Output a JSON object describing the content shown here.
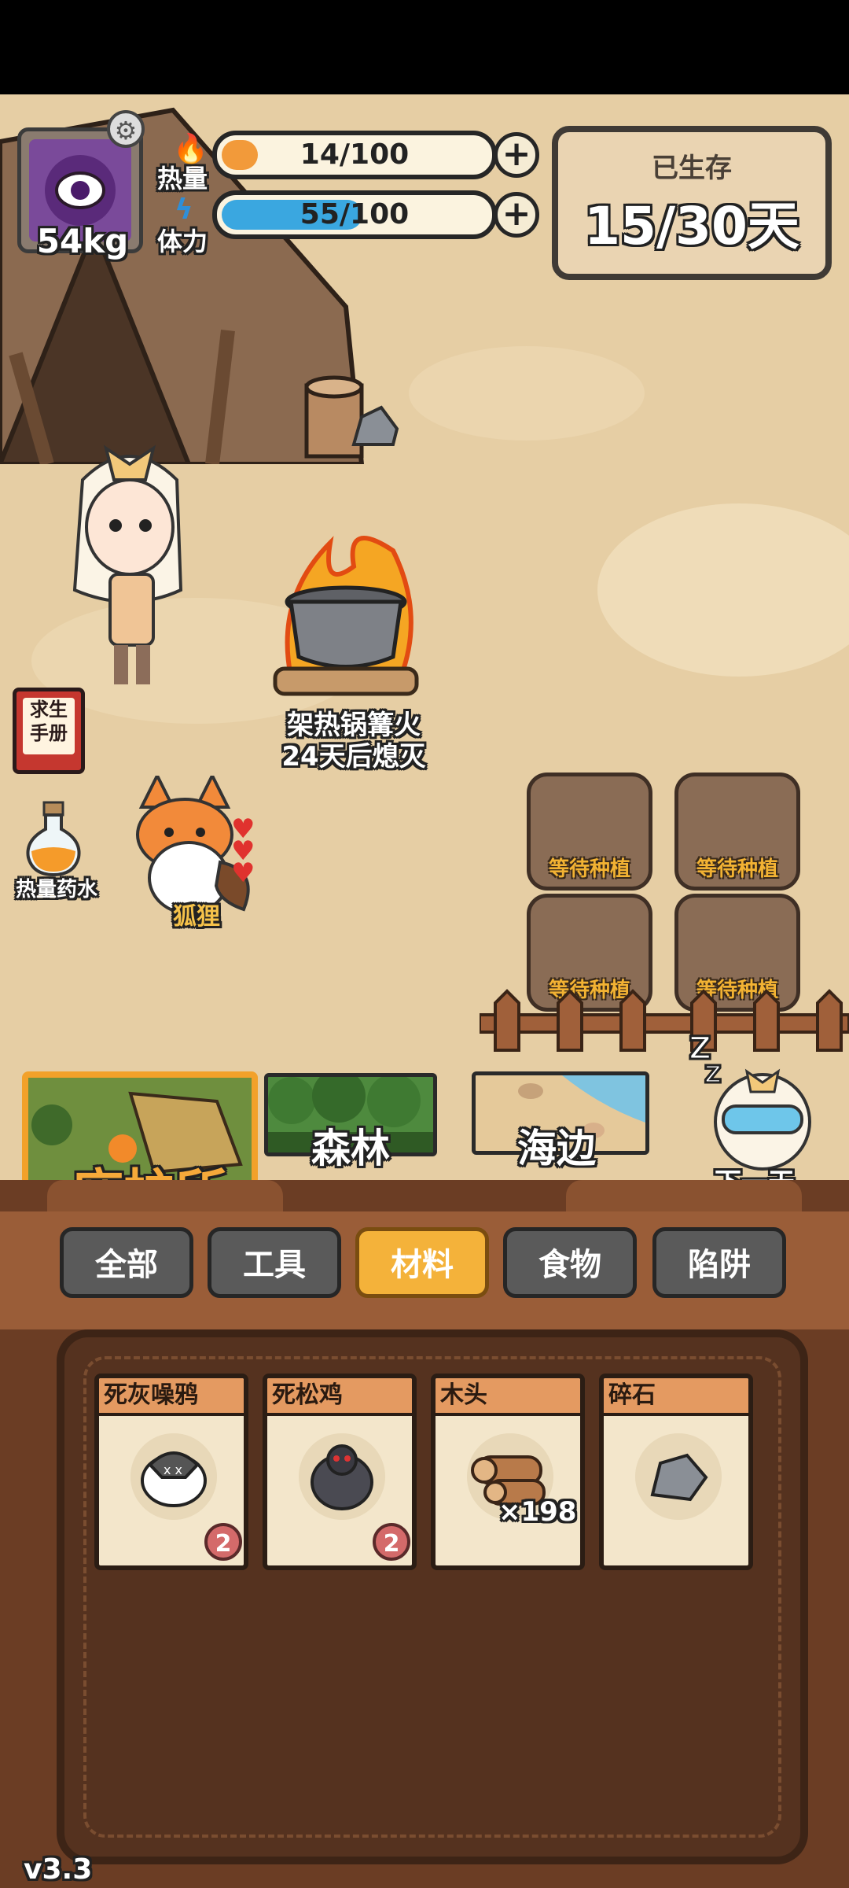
{
  "hud": {
    "avatar_weight": "54kg",
    "heat_label": "热量",
    "heat_value": "14/100",
    "heat_fraction": 0.14,
    "stamina_label": "体力",
    "stamina_value": "55/100",
    "stamina_fraction": 0.55,
    "survived_label": "已生存",
    "survived_days": "15/30天"
  },
  "scene": {
    "campfire_name": "架热锅篝火",
    "campfire_status": "24天后熄灭",
    "guide_book_label": "求生\n手册",
    "potion_label": "热量药水",
    "pet_name": "狐狸",
    "plots": [
      "等待种植",
      "等待种植",
      "等待种植",
      "等待种植"
    ]
  },
  "locations": {
    "shelter": "庇护所",
    "forest": "森林",
    "seaside": "海边",
    "next_day": "下一天"
  },
  "tabs": [
    {
      "label": "全部",
      "active": false
    },
    {
      "label": "工具",
      "active": false
    },
    {
      "label": "材料",
      "active": true
    },
    {
      "label": "食物",
      "active": false
    },
    {
      "label": "陷阱",
      "active": false
    }
  ],
  "inventory": [
    {
      "name": "死灰噪鸦",
      "count": "2",
      "icon": "dead-crow-icon"
    },
    {
      "name": "死松鸡",
      "count": "2",
      "icon": "dead-grouse-icon"
    },
    {
      "name": "木头",
      "count": "×198",
      "icon": "wood-log-icon"
    },
    {
      "name": "碎石",
      "count": "",
      "icon": "stone-icon"
    }
  ],
  "version": "v3.3",
  "colors": {
    "heat_bar": "#f29a3a",
    "stamina_bar": "#3aa7e0",
    "active_tab": "#f4b23a",
    "plot_label": "#f2b233"
  }
}
